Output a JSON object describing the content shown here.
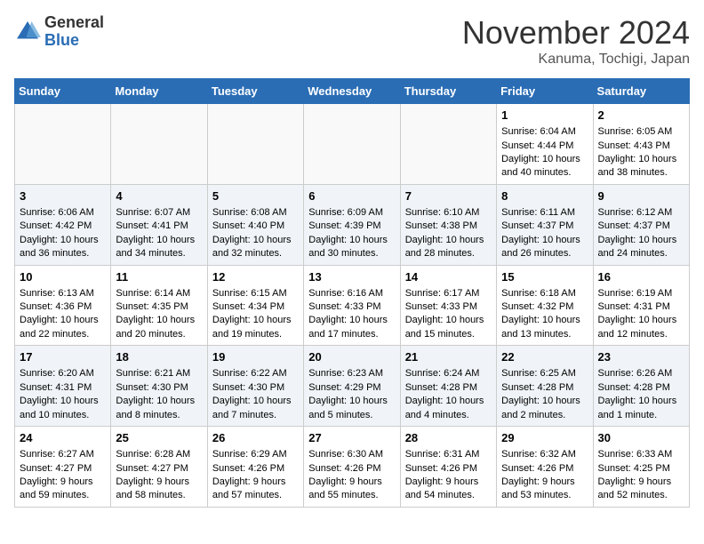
{
  "header": {
    "logo_general": "General",
    "logo_blue": "Blue",
    "month_title": "November 2024",
    "location": "Kanuma, Tochigi, Japan"
  },
  "calendar": {
    "days_of_week": [
      "Sunday",
      "Monday",
      "Tuesday",
      "Wednesday",
      "Thursday",
      "Friday",
      "Saturday"
    ],
    "weeks": [
      [
        {
          "day": "",
          "content": ""
        },
        {
          "day": "",
          "content": ""
        },
        {
          "day": "",
          "content": ""
        },
        {
          "day": "",
          "content": ""
        },
        {
          "day": "",
          "content": ""
        },
        {
          "day": "1",
          "content": "Sunrise: 6:04 AM\nSunset: 4:44 PM\nDaylight: 10 hours and 40 minutes."
        },
        {
          "day": "2",
          "content": "Sunrise: 6:05 AM\nSunset: 4:43 PM\nDaylight: 10 hours and 38 minutes."
        }
      ],
      [
        {
          "day": "3",
          "content": "Sunrise: 6:06 AM\nSunset: 4:42 PM\nDaylight: 10 hours and 36 minutes."
        },
        {
          "day": "4",
          "content": "Sunrise: 6:07 AM\nSunset: 4:41 PM\nDaylight: 10 hours and 34 minutes."
        },
        {
          "day": "5",
          "content": "Sunrise: 6:08 AM\nSunset: 4:40 PM\nDaylight: 10 hours and 32 minutes."
        },
        {
          "day": "6",
          "content": "Sunrise: 6:09 AM\nSunset: 4:39 PM\nDaylight: 10 hours and 30 minutes."
        },
        {
          "day": "7",
          "content": "Sunrise: 6:10 AM\nSunset: 4:38 PM\nDaylight: 10 hours and 28 minutes."
        },
        {
          "day": "8",
          "content": "Sunrise: 6:11 AM\nSunset: 4:37 PM\nDaylight: 10 hours and 26 minutes."
        },
        {
          "day": "9",
          "content": "Sunrise: 6:12 AM\nSunset: 4:37 PM\nDaylight: 10 hours and 24 minutes."
        }
      ],
      [
        {
          "day": "10",
          "content": "Sunrise: 6:13 AM\nSunset: 4:36 PM\nDaylight: 10 hours and 22 minutes."
        },
        {
          "day": "11",
          "content": "Sunrise: 6:14 AM\nSunset: 4:35 PM\nDaylight: 10 hours and 20 minutes."
        },
        {
          "day": "12",
          "content": "Sunrise: 6:15 AM\nSunset: 4:34 PM\nDaylight: 10 hours and 19 minutes."
        },
        {
          "day": "13",
          "content": "Sunrise: 6:16 AM\nSunset: 4:33 PM\nDaylight: 10 hours and 17 minutes."
        },
        {
          "day": "14",
          "content": "Sunrise: 6:17 AM\nSunset: 4:33 PM\nDaylight: 10 hours and 15 minutes."
        },
        {
          "day": "15",
          "content": "Sunrise: 6:18 AM\nSunset: 4:32 PM\nDaylight: 10 hours and 13 minutes."
        },
        {
          "day": "16",
          "content": "Sunrise: 6:19 AM\nSunset: 4:31 PM\nDaylight: 10 hours and 12 minutes."
        }
      ],
      [
        {
          "day": "17",
          "content": "Sunrise: 6:20 AM\nSunset: 4:31 PM\nDaylight: 10 hours and 10 minutes."
        },
        {
          "day": "18",
          "content": "Sunrise: 6:21 AM\nSunset: 4:30 PM\nDaylight: 10 hours and 8 minutes."
        },
        {
          "day": "19",
          "content": "Sunrise: 6:22 AM\nSunset: 4:30 PM\nDaylight: 10 hours and 7 minutes."
        },
        {
          "day": "20",
          "content": "Sunrise: 6:23 AM\nSunset: 4:29 PM\nDaylight: 10 hours and 5 minutes."
        },
        {
          "day": "21",
          "content": "Sunrise: 6:24 AM\nSunset: 4:28 PM\nDaylight: 10 hours and 4 minutes."
        },
        {
          "day": "22",
          "content": "Sunrise: 6:25 AM\nSunset: 4:28 PM\nDaylight: 10 hours and 2 minutes."
        },
        {
          "day": "23",
          "content": "Sunrise: 6:26 AM\nSunset: 4:28 PM\nDaylight: 10 hours and 1 minute."
        }
      ],
      [
        {
          "day": "24",
          "content": "Sunrise: 6:27 AM\nSunset: 4:27 PM\nDaylight: 9 hours and 59 minutes."
        },
        {
          "day": "25",
          "content": "Sunrise: 6:28 AM\nSunset: 4:27 PM\nDaylight: 9 hours and 58 minutes."
        },
        {
          "day": "26",
          "content": "Sunrise: 6:29 AM\nSunset: 4:26 PM\nDaylight: 9 hours and 57 minutes."
        },
        {
          "day": "27",
          "content": "Sunrise: 6:30 AM\nSunset: 4:26 PM\nDaylight: 9 hours and 55 minutes."
        },
        {
          "day": "28",
          "content": "Sunrise: 6:31 AM\nSunset: 4:26 PM\nDaylight: 9 hours and 54 minutes."
        },
        {
          "day": "29",
          "content": "Sunrise: 6:32 AM\nSunset: 4:26 PM\nDaylight: 9 hours and 53 minutes."
        },
        {
          "day": "30",
          "content": "Sunrise: 6:33 AM\nSunset: 4:25 PM\nDaylight: 9 hours and 52 minutes."
        }
      ]
    ]
  }
}
